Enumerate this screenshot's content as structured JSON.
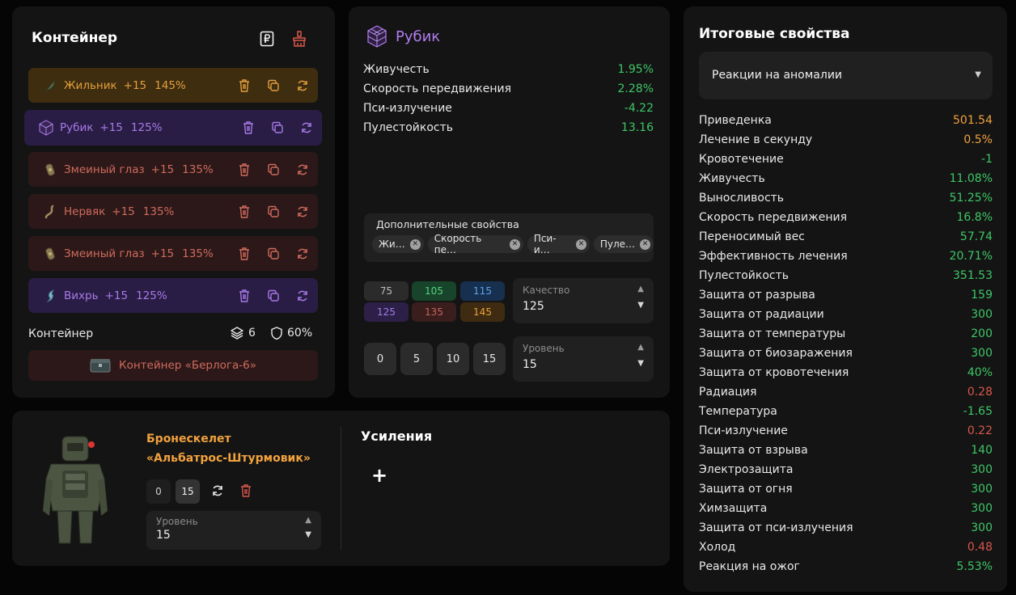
{
  "container": {
    "title": "Контейнер",
    "artifacts": [
      {
        "name": "Жильник",
        "bonus": "+15",
        "quality": "145%",
        "color": "orange",
        "icon": "zhilnik-icon"
      },
      {
        "name": "Рубик",
        "bonus": "+15",
        "quality": "125%",
        "color": "purple",
        "icon": "rubik-icon"
      },
      {
        "name": "Змеиный глаз",
        "bonus": "+15",
        "quality": "135%",
        "color": "red",
        "icon": "snake-eye-icon"
      },
      {
        "name": "Нервяк",
        "bonus": "+15",
        "quality": "135%",
        "color": "red",
        "icon": "nervyak-icon"
      },
      {
        "name": "Змеиный глаз",
        "bonus": "+15",
        "quality": "135%",
        "color": "red",
        "icon": "snake-eye-icon"
      },
      {
        "name": "Вихрь",
        "bonus": "+15",
        "quality": "125%",
        "color": "purple",
        "icon": "vikhr-icon"
      }
    ],
    "footer_label": "Контейнер",
    "slots": "6",
    "protection": "60%",
    "selected_container": "Контейнер «Берлога-6»"
  },
  "artifact": {
    "title": "Рубик",
    "stats": [
      {
        "label": "Живучесть",
        "value": "1.95%",
        "color": "green"
      },
      {
        "label": "Скорость передвижения",
        "value": "2.28%",
        "color": "green"
      },
      {
        "label": "Пси-излучение",
        "value": "-4.22",
        "color": "green"
      },
      {
        "label": "Пулестойкость",
        "value": "13.16",
        "color": "green"
      }
    ],
    "extra_title": "Дополнительные свойства",
    "extra_chips": [
      "Жи…",
      "Скорость пе…",
      "Пси-и…",
      "Пуле…"
    ],
    "quality_presets": [
      {
        "value": "75",
        "color": "#2b2b2b",
        "text": "#bdbdbd"
      },
      {
        "value": "105",
        "color": "#17442a",
        "text": "#56d37f"
      },
      {
        "value": "115",
        "color": "#17304f",
        "text": "#5ea3ea"
      },
      {
        "value": "125",
        "color": "#2c2049",
        "text": "#a07ee4"
      },
      {
        "value": "135",
        "color": "#3a1d1d",
        "text": "#c5645b"
      },
      {
        "value": "145",
        "color": "#3f2b11",
        "text": "#e8a23c"
      }
    ],
    "quality_label": "Качество",
    "quality_value": "125",
    "level_presets": [
      "0",
      "5",
      "10",
      "15"
    ],
    "level_label": "Уровень",
    "level_value": "15"
  },
  "armor": {
    "name_line1": "Бронескелет",
    "name_line2": "«Альбатрос-Штурмовик»",
    "level_presets": [
      "0",
      "15"
    ],
    "level_label": "Уровень",
    "level_value": "15",
    "boosts_title": "Усиления",
    "add_symbol": "+"
  },
  "summary": {
    "title": "Итоговые свойства",
    "dropdown_value": "Реакции на аномалии",
    "stats": [
      {
        "label": "Приведенка",
        "value": "501.54",
        "color": "orange"
      },
      {
        "label": "Лечение в секунду",
        "value": "0.5%",
        "color": "orange"
      },
      {
        "label": "Кровотечение",
        "value": "-1",
        "color": "green"
      },
      {
        "label": "Живучесть",
        "value": "11.08%",
        "color": "green"
      },
      {
        "label": "Выносливость",
        "value": "51.25%",
        "color": "green"
      },
      {
        "label": "Скорость передвижения",
        "value": "16.8%",
        "color": "green"
      },
      {
        "label": "Переносимый вес",
        "value": "57.74",
        "color": "green"
      },
      {
        "label": "Эффективность лечения",
        "value": "20.71%",
        "color": "green"
      },
      {
        "label": "Пулестойкость",
        "value": "351.53",
        "color": "green"
      },
      {
        "label": "Защита от разрыва",
        "value": "159",
        "color": "green"
      },
      {
        "label": "Защита от радиации",
        "value": "300",
        "color": "green"
      },
      {
        "label": "Защита от температуры",
        "value": "200",
        "color": "green"
      },
      {
        "label": "Защита от биозаражения",
        "value": "300",
        "color": "green"
      },
      {
        "label": "Защита от кровотечения",
        "value": "40%",
        "color": "green"
      },
      {
        "label": "Радиация",
        "value": "0.28",
        "color": "red"
      },
      {
        "label": "Температура",
        "value": "-1.65",
        "color": "green"
      },
      {
        "label": "Пси-излучение",
        "value": "0.22",
        "color": "red"
      },
      {
        "label": "Защита от взрыва",
        "value": "140",
        "color": "green"
      },
      {
        "label": "Электрозащита",
        "value": "300",
        "color": "green"
      },
      {
        "label": "Защита от огня",
        "value": "300",
        "color": "green"
      },
      {
        "label": "Химзащита",
        "value": "300",
        "color": "green"
      },
      {
        "label": "Защита от пси-излучения",
        "value": "300",
        "color": "green"
      },
      {
        "label": "Холод",
        "value": "0.48",
        "color": "red"
      },
      {
        "label": "Реакция на ожог",
        "value": "5.53%",
        "color": "green"
      }
    ]
  },
  "colors": {
    "green": "#3ec767",
    "orange": "#f2a23d",
    "red": "#d7574c",
    "purple": "#a67ae6"
  }
}
